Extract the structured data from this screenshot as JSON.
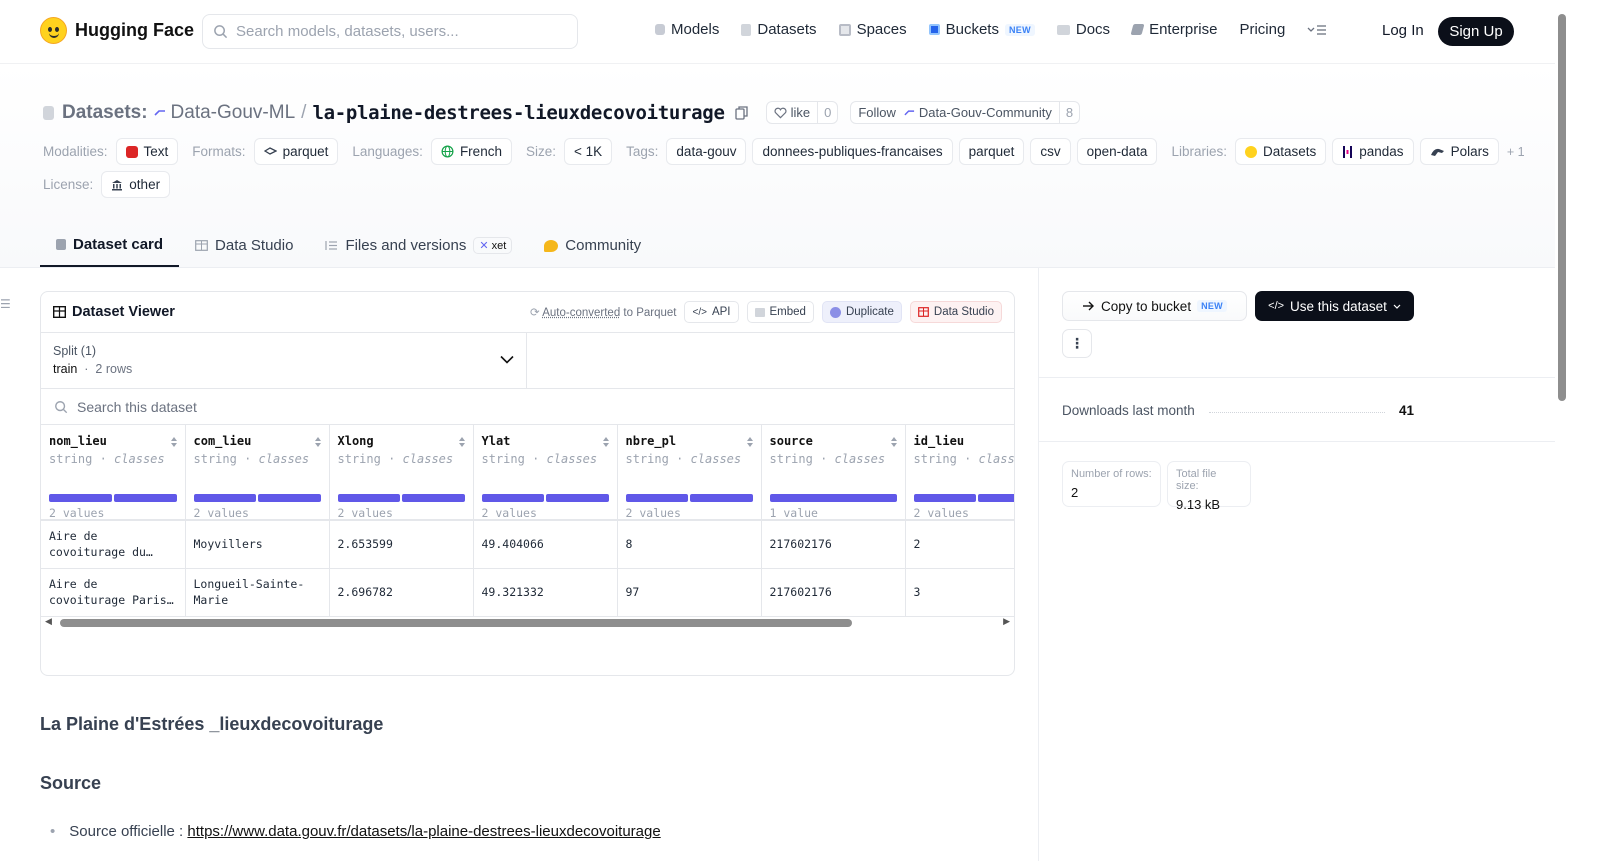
{
  "nav": {
    "brand": "Hugging Face",
    "search_placeholder": "Search models, datasets, users...",
    "links": [
      "Models",
      "Datasets",
      "Spaces",
      "Buckets",
      "Docs",
      "Enterprise",
      "Pricing"
    ],
    "buckets_badge": "NEW",
    "login": "Log In",
    "signup": "Sign Up"
  },
  "header": {
    "section": "Datasets:",
    "org": "Data-Gouv-ML",
    "sep": "/",
    "name": "la-plaine-destrees-lieuxdecovoiturage",
    "like_label": "like",
    "like_count": "0",
    "follow_label": "Follow",
    "follow_org": "Data-Gouv-Community",
    "follow_count": "8"
  },
  "tags": {
    "modalities_label": "Modalities:",
    "modality": "Text",
    "formats_label": "Formats:",
    "format": "parquet",
    "languages_label": "Languages:",
    "language": "French",
    "size_label": "Size:",
    "size": "< 1K",
    "tags_label": "Tags:",
    "tag_list": [
      "data-gouv",
      "donnees-publiques-francaises",
      "parquet",
      "csv",
      "open-data"
    ],
    "libraries_label": "Libraries:",
    "libraries": [
      "Datasets",
      "pandas",
      "Polars"
    ],
    "libraries_more": "+ 1",
    "license_label": "License:",
    "license": "other"
  },
  "tabs": [
    "Dataset card",
    "Data Studio",
    "Files and versions",
    "Community"
  ],
  "tabs_badge": "xet",
  "viewer": {
    "title": "Dataset Viewer",
    "auto_converted": "Auto-converted",
    "to_parquet": " to Parquet",
    "api": "API",
    "embed": "Embed",
    "duplicate": "Duplicate",
    "data_studio": "Data Studio",
    "split_label": "Split (1)",
    "split_name": "train",
    "split_rows": "2 rows",
    "search_placeholder": "Search this dataset",
    "columns": [
      {
        "name": "nom_lieu",
        "type": "string",
        "kind": "classes",
        "count": "2 values"
      },
      {
        "name": "com_lieu",
        "type": "string",
        "kind": "classes",
        "count": "2 values"
      },
      {
        "name": "Xlong",
        "type": "string",
        "kind": "classes",
        "count": "2 values"
      },
      {
        "name": "Ylat",
        "type": "string",
        "kind": "classes",
        "count": "2 values"
      },
      {
        "name": "nbre_pl",
        "type": "string",
        "kind": "classes",
        "count": "2 values"
      },
      {
        "name": "source",
        "type": "string",
        "kind": "classes",
        "count": "1 value"
      },
      {
        "name": "id_lieu",
        "type": "string",
        "kind": "classes",
        "count": "2 values"
      }
    ],
    "rows": [
      [
        "Aire de covoiturage du…",
        "Moyvillers",
        "2.653599",
        "49.404066",
        "8",
        "217602176",
        "2"
      ],
      [
        "Aire de covoiturage Paris…",
        "Longueil-Sainte-Marie",
        "2.696782",
        "49.321332",
        "97",
        "217602176",
        "3"
      ]
    ]
  },
  "card": {
    "heading": "La Plaine d'Estrées _lieuxdecovoiturage",
    "source_heading": "Source",
    "source_item_label": "Source officielle : ",
    "source_url": "https://www.data.gouv.fr/datasets/la-plaine-destrees-lieuxdecovoiturage"
  },
  "sidebar": {
    "copy_to_bucket": "Copy to bucket",
    "copy_badge": "NEW",
    "use_dataset": "Use this dataset",
    "downloads_label": "Downloads last month",
    "downloads_value": "41",
    "rows_label": "Number of rows:",
    "rows_value": "2",
    "size_label": "Total file size:",
    "size_value": "9.13 kB"
  },
  "colors": {
    "accent_dark": "#0b0f19",
    "histogram_bar": "#4f46e5",
    "brand_yellow": "#ffd21e"
  }
}
